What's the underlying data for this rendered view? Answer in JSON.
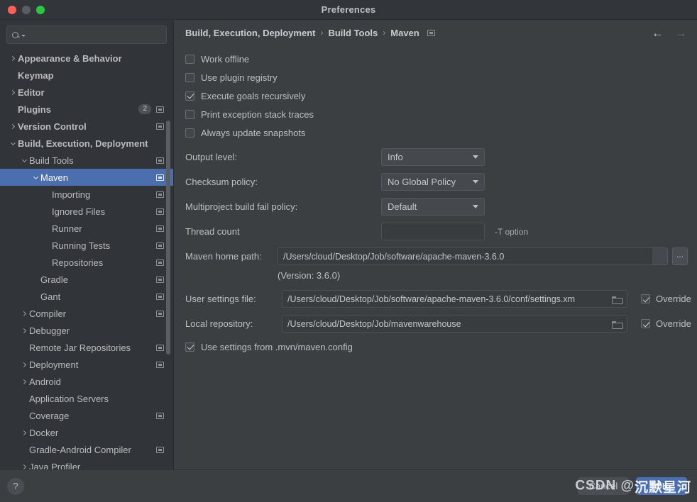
{
  "window": {
    "title": "Preferences",
    "traffic_lights": [
      "close-red",
      "minimize-yellow",
      "zoom-green"
    ]
  },
  "sidebar": {
    "search": {
      "value": "",
      "placeholder": "",
      "icon": "search-icon"
    },
    "items": [
      {
        "label": "Appearance & Behavior",
        "indent": 0,
        "arrow": "right",
        "bold": true,
        "badge": "",
        "panel_icon": false,
        "selected": false
      },
      {
        "label": "Keymap",
        "indent": 0,
        "arrow": "none",
        "bold": true,
        "badge": "",
        "panel_icon": false,
        "selected": false
      },
      {
        "label": "Editor",
        "indent": 0,
        "arrow": "right",
        "bold": true,
        "badge": "",
        "panel_icon": false,
        "selected": false
      },
      {
        "label": "Plugins",
        "indent": 0,
        "arrow": "none",
        "bold": true,
        "badge": "2",
        "panel_icon": true,
        "selected": false
      },
      {
        "label": "Version Control",
        "indent": 0,
        "arrow": "right",
        "bold": true,
        "badge": "",
        "panel_icon": true,
        "selected": false
      },
      {
        "label": "Build, Execution, Deployment",
        "indent": 0,
        "arrow": "down",
        "bold": true,
        "badge": "",
        "panel_icon": false,
        "selected": false
      },
      {
        "label": "Build Tools",
        "indent": 1,
        "arrow": "down",
        "bold": false,
        "badge": "",
        "panel_icon": true,
        "selected": false
      },
      {
        "label": "Maven",
        "indent": 2,
        "arrow": "down",
        "bold": false,
        "badge": "",
        "panel_icon": true,
        "selected": true
      },
      {
        "label": "Importing",
        "indent": 3,
        "arrow": "none",
        "bold": false,
        "badge": "",
        "panel_icon": true,
        "selected": false
      },
      {
        "label": "Ignored Files",
        "indent": 3,
        "arrow": "none",
        "bold": false,
        "badge": "",
        "panel_icon": true,
        "selected": false
      },
      {
        "label": "Runner",
        "indent": 3,
        "arrow": "none",
        "bold": false,
        "badge": "",
        "panel_icon": true,
        "selected": false
      },
      {
        "label": "Running Tests",
        "indent": 3,
        "arrow": "none",
        "bold": false,
        "badge": "",
        "panel_icon": true,
        "selected": false
      },
      {
        "label": "Repositories",
        "indent": 3,
        "arrow": "none",
        "bold": false,
        "badge": "",
        "panel_icon": true,
        "selected": false
      },
      {
        "label": "Gradle",
        "indent": 2,
        "arrow": "none",
        "bold": false,
        "badge": "",
        "panel_icon": true,
        "selected": false
      },
      {
        "label": "Gant",
        "indent": 2,
        "arrow": "none",
        "bold": false,
        "badge": "",
        "panel_icon": true,
        "selected": false
      },
      {
        "label": "Compiler",
        "indent": 1,
        "arrow": "right",
        "bold": false,
        "badge": "",
        "panel_icon": true,
        "selected": false
      },
      {
        "label": "Debugger",
        "indent": 1,
        "arrow": "right",
        "bold": false,
        "badge": "",
        "panel_icon": false,
        "selected": false
      },
      {
        "label": "Remote Jar Repositories",
        "indent": 1,
        "arrow": "none",
        "bold": false,
        "badge": "",
        "panel_icon": true,
        "selected": false
      },
      {
        "label": "Deployment",
        "indent": 1,
        "arrow": "right",
        "bold": false,
        "badge": "",
        "panel_icon": true,
        "selected": false
      },
      {
        "label": "Android",
        "indent": 1,
        "arrow": "right",
        "bold": false,
        "badge": "",
        "panel_icon": false,
        "selected": false
      },
      {
        "label": "Application Servers",
        "indent": 1,
        "arrow": "none",
        "bold": false,
        "badge": "",
        "panel_icon": false,
        "selected": false
      },
      {
        "label": "Coverage",
        "indent": 1,
        "arrow": "none",
        "bold": false,
        "badge": "",
        "panel_icon": true,
        "selected": false
      },
      {
        "label": "Docker",
        "indent": 1,
        "arrow": "right",
        "bold": false,
        "badge": "",
        "panel_icon": false,
        "selected": false
      },
      {
        "label": "Gradle-Android Compiler",
        "indent": 1,
        "arrow": "none",
        "bold": false,
        "badge": "",
        "panel_icon": true,
        "selected": false
      },
      {
        "label": "Java Profiler",
        "indent": 1,
        "arrow": "right",
        "bold": false,
        "badge": "",
        "panel_icon": false,
        "selected": false
      }
    ]
  },
  "breadcrumb": {
    "parts": [
      "Build, Execution, Deployment",
      "Build Tools",
      "Maven"
    ],
    "separator": "›",
    "panel_icon": "window-icon",
    "nav_back": "←",
    "nav_forward": "→"
  },
  "main": {
    "checkboxes": [
      {
        "label": "Work offline",
        "checked": false
      },
      {
        "label": "Use plugin registry",
        "checked": false
      },
      {
        "label": "Execute goals recursively",
        "checked": true
      },
      {
        "label": "Print exception stack traces",
        "checked": false
      },
      {
        "label": "Always update snapshots",
        "checked": false
      }
    ],
    "output_level": {
      "label": "Output level:",
      "value": "Info"
    },
    "checksum_policy": {
      "label": "Checksum policy:",
      "value": "No Global Policy"
    },
    "multiproject_policy": {
      "label": "Multiproject build fail policy:",
      "value": "Default"
    },
    "thread_count": {
      "label": "Thread count",
      "value": "",
      "hint": "-T option"
    },
    "maven_home": {
      "label": "Maven home path:",
      "value": "/Users/cloud/Desktop/Job/software/apache-maven-3.6.0",
      "version_note": "(Version: 3.6.0)",
      "browse_label": "..."
    },
    "user_settings": {
      "label": "User settings file:",
      "value": "/Users/cloud/Desktop/Job/software/apache-maven-3.6.0/conf/settings.xm",
      "override_label": "Override",
      "override_checked": true
    },
    "local_repository": {
      "label": "Local repository:",
      "value": "/Users/cloud/Desktop/Job/mavenwarehouse",
      "override_label": "Override",
      "override_checked": true
    },
    "mvn_config": {
      "label": "Use settings from .mvn/maven.config",
      "checked": true
    }
  },
  "footer": {
    "help_label": "?",
    "cancel_label": "Cancel",
    "ok_label": "OK",
    "watermark_prefix": "CSDN @",
    "watermark_name": "沉默星河"
  },
  "colors": {
    "accent_blue": "#4b6eaf",
    "window_bg": "#3c3f41",
    "sidebar_bg": "#313438",
    "text": "#bcc0c4"
  }
}
